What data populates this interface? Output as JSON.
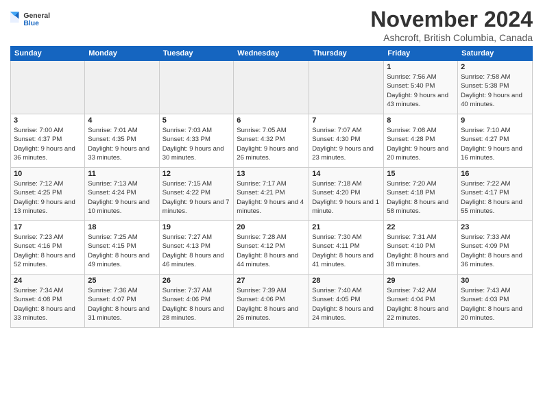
{
  "header": {
    "logo_general": "General",
    "logo_blue": "Blue",
    "month": "November 2024",
    "location": "Ashcroft, British Columbia, Canada"
  },
  "weekdays": [
    "Sunday",
    "Monday",
    "Tuesday",
    "Wednesday",
    "Thursday",
    "Friday",
    "Saturday"
  ],
  "weeks": [
    [
      {
        "day": "",
        "info": ""
      },
      {
        "day": "",
        "info": ""
      },
      {
        "day": "",
        "info": ""
      },
      {
        "day": "",
        "info": ""
      },
      {
        "day": "",
        "info": ""
      },
      {
        "day": "1",
        "info": "Sunrise: 7:56 AM\nSunset: 5:40 PM\nDaylight: 9 hours\nand 43 minutes."
      },
      {
        "day": "2",
        "info": "Sunrise: 7:58 AM\nSunset: 5:38 PM\nDaylight: 9 hours\nand 40 minutes."
      }
    ],
    [
      {
        "day": "3",
        "info": "Sunrise: 7:00 AM\nSunset: 4:37 PM\nDaylight: 9 hours\nand 36 minutes."
      },
      {
        "day": "4",
        "info": "Sunrise: 7:01 AM\nSunset: 4:35 PM\nDaylight: 9 hours\nand 33 minutes."
      },
      {
        "day": "5",
        "info": "Sunrise: 7:03 AM\nSunset: 4:33 PM\nDaylight: 9 hours\nand 30 minutes."
      },
      {
        "day": "6",
        "info": "Sunrise: 7:05 AM\nSunset: 4:32 PM\nDaylight: 9 hours\nand 26 minutes."
      },
      {
        "day": "7",
        "info": "Sunrise: 7:07 AM\nSunset: 4:30 PM\nDaylight: 9 hours\nand 23 minutes."
      },
      {
        "day": "8",
        "info": "Sunrise: 7:08 AM\nSunset: 4:28 PM\nDaylight: 9 hours\nand 20 minutes."
      },
      {
        "day": "9",
        "info": "Sunrise: 7:10 AM\nSunset: 4:27 PM\nDaylight: 9 hours\nand 16 minutes."
      }
    ],
    [
      {
        "day": "10",
        "info": "Sunrise: 7:12 AM\nSunset: 4:25 PM\nDaylight: 9 hours\nand 13 minutes."
      },
      {
        "day": "11",
        "info": "Sunrise: 7:13 AM\nSunset: 4:24 PM\nDaylight: 9 hours\nand 10 minutes."
      },
      {
        "day": "12",
        "info": "Sunrise: 7:15 AM\nSunset: 4:22 PM\nDaylight: 9 hours\nand 7 minutes."
      },
      {
        "day": "13",
        "info": "Sunrise: 7:17 AM\nSunset: 4:21 PM\nDaylight: 9 hours\nand 4 minutes."
      },
      {
        "day": "14",
        "info": "Sunrise: 7:18 AM\nSunset: 4:20 PM\nDaylight: 9 hours\nand 1 minute."
      },
      {
        "day": "15",
        "info": "Sunrise: 7:20 AM\nSunset: 4:18 PM\nDaylight: 8 hours\nand 58 minutes."
      },
      {
        "day": "16",
        "info": "Sunrise: 7:22 AM\nSunset: 4:17 PM\nDaylight: 8 hours\nand 55 minutes."
      }
    ],
    [
      {
        "day": "17",
        "info": "Sunrise: 7:23 AM\nSunset: 4:16 PM\nDaylight: 8 hours\nand 52 minutes."
      },
      {
        "day": "18",
        "info": "Sunrise: 7:25 AM\nSunset: 4:15 PM\nDaylight: 8 hours\nand 49 minutes."
      },
      {
        "day": "19",
        "info": "Sunrise: 7:27 AM\nSunset: 4:13 PM\nDaylight: 8 hours\nand 46 minutes."
      },
      {
        "day": "20",
        "info": "Sunrise: 7:28 AM\nSunset: 4:12 PM\nDaylight: 8 hours\nand 44 minutes."
      },
      {
        "day": "21",
        "info": "Sunrise: 7:30 AM\nSunset: 4:11 PM\nDaylight: 8 hours\nand 41 minutes."
      },
      {
        "day": "22",
        "info": "Sunrise: 7:31 AM\nSunset: 4:10 PM\nDaylight: 8 hours\nand 38 minutes."
      },
      {
        "day": "23",
        "info": "Sunrise: 7:33 AM\nSunset: 4:09 PM\nDaylight: 8 hours\nand 36 minutes."
      }
    ],
    [
      {
        "day": "24",
        "info": "Sunrise: 7:34 AM\nSunset: 4:08 PM\nDaylight: 8 hours\nand 33 minutes."
      },
      {
        "day": "25",
        "info": "Sunrise: 7:36 AM\nSunset: 4:07 PM\nDaylight: 8 hours\nand 31 minutes."
      },
      {
        "day": "26",
        "info": "Sunrise: 7:37 AM\nSunset: 4:06 PM\nDaylight: 8 hours\nand 28 minutes."
      },
      {
        "day": "27",
        "info": "Sunrise: 7:39 AM\nSunset: 4:06 PM\nDaylight: 8 hours\nand 26 minutes."
      },
      {
        "day": "28",
        "info": "Sunrise: 7:40 AM\nSunset: 4:05 PM\nDaylight: 8 hours\nand 24 minutes."
      },
      {
        "day": "29",
        "info": "Sunrise: 7:42 AM\nSunset: 4:04 PM\nDaylight: 8 hours\nand 22 minutes."
      },
      {
        "day": "30",
        "info": "Sunrise: 7:43 AM\nSunset: 4:03 PM\nDaylight: 8 hours\nand 20 minutes."
      }
    ]
  ]
}
